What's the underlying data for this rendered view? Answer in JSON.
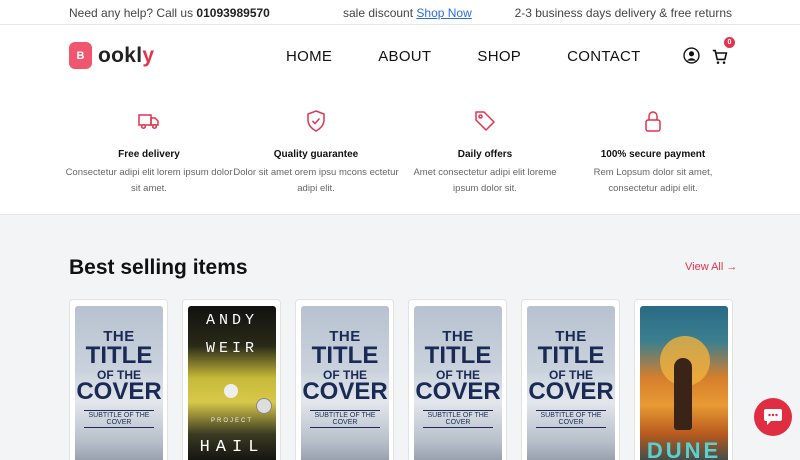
{
  "topbar": {
    "help_text": "Need any help? Call us",
    "phone": "01093989570",
    "promo_text": "sale discount",
    "promo_link": "Shop Now",
    "delivery_text": "2-3 business days delivery & free returns"
  },
  "header": {
    "logo_letter": "B",
    "logo_text": "ookl",
    "logo_tail": "y",
    "nav": [
      "HOME",
      "ABOUT",
      "SHOP",
      "CONTACT"
    ],
    "cart_count": "0"
  },
  "features": [
    {
      "icon": "truck-icon",
      "title": "Free delivery",
      "desc": "Consectetur adipi elit lorem ipsum dolor sit amet."
    },
    {
      "icon": "shield-check-icon",
      "title": "Quality guarantee",
      "desc": "Dolor sit amet orem ipsu mcons ectetur adipi elit."
    },
    {
      "icon": "tag-icon",
      "title": "Daily offers",
      "desc": "Amet consectetur adipi elit loreme ipsum dolor sit."
    },
    {
      "icon": "lock-icon",
      "title": "100% secure payment",
      "desc": "Rem Lopsum dolor sit amet, consectetur adipi elit."
    }
  ],
  "best_selling": {
    "title": "Best selling items",
    "view_all": "View All →",
    "books": [
      {
        "cover": "standard",
        "lines": [
          "THE",
          "TITLE",
          "OF THE",
          "COVER",
          "SUBTITLE OF THE COVER"
        ]
      },
      {
        "cover": "hail",
        "lines": [
          "ANDY",
          "WEIR",
          "PROJECT",
          "HAIL"
        ]
      },
      {
        "cover": "standard",
        "lines": [
          "THE",
          "TITLE",
          "OF THE",
          "COVER",
          "SUBTITLE OF THE COVER"
        ]
      },
      {
        "cover": "standard",
        "lines": [
          "THE",
          "TITLE",
          "OF THE",
          "COVER",
          "SUBTITLE OF THE COVER"
        ]
      },
      {
        "cover": "standard",
        "lines": [
          "THE",
          "TITLE",
          "OF THE",
          "COVER",
          "SUBTITLE OF THE COVER"
        ]
      },
      {
        "cover": "dune",
        "lines": [
          "DUNE"
        ]
      }
    ]
  },
  "colors": {
    "accent": "#e0344f",
    "brand_badge": "#f0566e",
    "link": "#2a6fd6"
  }
}
